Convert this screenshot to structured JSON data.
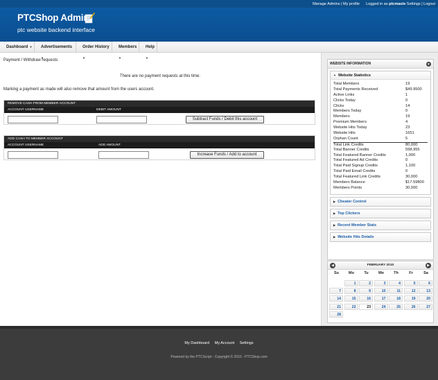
{
  "topbar": {
    "manage_admins": "Manage Admins",
    "my_profile": "My profile",
    "logged_in_as": "Logged in as",
    "username": "ptcmaste",
    "settings": "Settings",
    "logout": "Logout"
  },
  "header": {
    "title": "PTCShop Admin",
    "subtitle": "ptc website backend interface"
  },
  "nav": [
    {
      "label": "Dashboard"
    },
    {
      "label": "Advertisements"
    },
    {
      "label": "Order History"
    },
    {
      "label": "Members"
    },
    {
      "label": "Help"
    }
  ],
  "main": {
    "page_title": "Payment / Withdraw requests",
    "notice": "There are no payment requests at this time.",
    "note": "Marking a payment as made will also remove that amount from the users account.",
    "remove_form": {
      "title": "REMOVE CASH FROM MEMBER ACCOUNT",
      "col_username": "ACCOUNT USERNAME",
      "col_amount": "DEBIT AMOUNT",
      "username_value": "",
      "amount_value": "",
      "button": "Subtract Funds / Debit this account"
    },
    "add_form": {
      "title": "ADD CASH TO MEMBER ACCOUNT",
      "col_username": "ACCOUNT USERNAME",
      "col_amount": "ADD AMOUNT",
      "username_value": "",
      "amount_value": "",
      "button": "Increase Funds / Add to account"
    }
  },
  "sidebar": {
    "widget_title": "WEBSITE INFORMATION",
    "stats_title": "Website Statistics",
    "stats": [
      {
        "label": "Total Members",
        "value": "19"
      },
      {
        "label": "Total Payments Received",
        "value": "$49.9500"
      },
      {
        "label": "Active Links",
        "value": "1"
      },
      {
        "label": "Clicks Today",
        "value": "0"
      },
      {
        "label": "Clicks",
        "value": "14"
      },
      {
        "label": "Members Today",
        "value": "0"
      },
      {
        "label": "Members",
        "value": "19"
      },
      {
        "label": "Premium Members",
        "value": "4"
      },
      {
        "label": "Website Hits Today",
        "value": "23"
      },
      {
        "label": "Website Hits",
        "value": "1651"
      },
      {
        "label": "Orphan Count",
        "value": "5"
      },
      {
        "label": "Total Link Credits",
        "value": "80,000"
      },
      {
        "label": "Total Banner Credits",
        "value": "598,955"
      },
      {
        "label": "Total Featured Banner Credits",
        "value": "1,000"
      },
      {
        "label": "Total Featured Ad Credits",
        "value": "0"
      },
      {
        "label": "Total Paid Signup Credits",
        "value": "1,100"
      },
      {
        "label": "Total Paid Email Credits",
        "value": "0"
      },
      {
        "label": "Total Featured Link Credits",
        "value": "30,000"
      },
      {
        "label": "Members Balance",
        "value": "$17.59800"
      },
      {
        "label": "Members Points",
        "value": "30,000"
      }
    ],
    "sections": [
      {
        "label": "Cheater Control"
      },
      {
        "label": "Top Clickers"
      },
      {
        "label": "Recent Member Stats"
      },
      {
        "label": "Website Hits Details"
      }
    ]
  },
  "calendar": {
    "month": "FEBRUARY 2010",
    "dow": [
      "Su",
      "Mo",
      "Tu",
      "We",
      "Th",
      "Fr",
      "Sa"
    ],
    "first_weekday": 1,
    "days": 28,
    "today": 23
  },
  "footer": {
    "links": [
      "My Dashboard",
      "My Account",
      "Settings"
    ],
    "copyright": "Powered by the PTCScript - Copyright © 2010 - PTCShop.com"
  }
}
